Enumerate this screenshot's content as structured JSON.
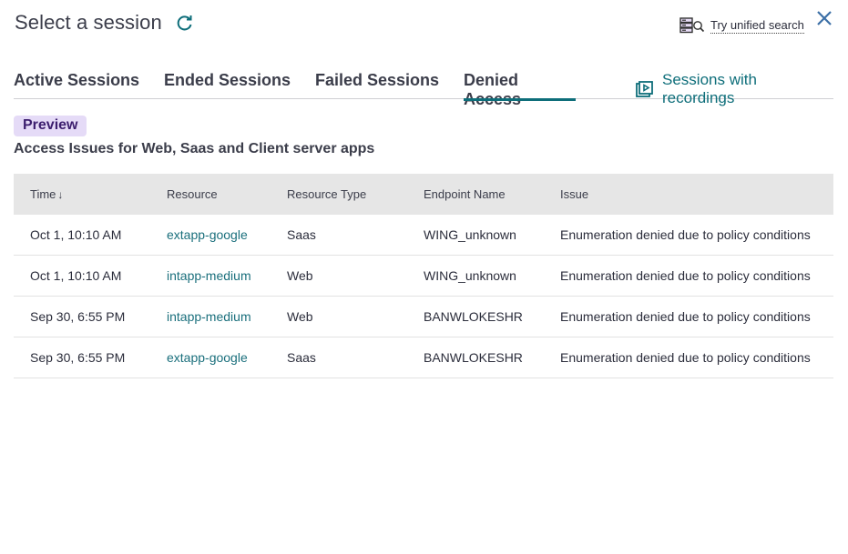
{
  "header": {
    "title": "Select a session",
    "refresh_icon": "refresh-icon",
    "unified_search_label": "Try unified search",
    "unified_search_icon": "unified-search-icon",
    "close_icon": "close-icon"
  },
  "tabs": [
    {
      "label": "Active Sessions",
      "active": false
    },
    {
      "label": "Ended Sessions",
      "active": false
    },
    {
      "label": "Failed Sessions",
      "active": false
    },
    {
      "label": "Denied Access",
      "active": true
    }
  ],
  "recordings": {
    "label": "Sessions with recordings",
    "icon": "recordings-icon"
  },
  "preview_badge": "Preview",
  "subtitle": "Access Issues for Web, Saas and Client server apps",
  "table": {
    "columns": [
      "Time",
      "Resource",
      "Resource Type",
      "Endpoint Name",
      "Issue"
    ],
    "sort_indicator": "↓",
    "rows": [
      {
        "time": "Oct 1, 10:10 AM",
        "resource": "extapp-google",
        "type": "Saas",
        "endpoint": "WING_unknown",
        "issue": "Enumeration denied due to policy conditions"
      },
      {
        "time": "Oct 1, 10:10 AM",
        "resource": "intapp-medium",
        "type": "Web",
        "endpoint": "WING_unknown",
        "issue": "Enumeration denied due to policy conditions"
      },
      {
        "time": "Sep 30, 6:55 PM",
        "resource": "intapp-medium",
        "type": "Web",
        "endpoint": "BANWLOKESHR",
        "issue": "Enumeration denied due to policy conditions"
      },
      {
        "time": "Sep 30, 6:55 PM",
        "resource": "extapp-google",
        "type": "Saas",
        "endpoint": "BANWLOKESHR",
        "issue": "Enumeration denied due to policy conditions"
      }
    ]
  },
  "colors": {
    "accent": "#0e6e7a",
    "link": "#1a6f7c",
    "close": "#3c6fa6",
    "preview_bg": "#e5dbf7",
    "preview_text": "#3c1e6e",
    "table_header_bg": "#e6e6e6"
  }
}
